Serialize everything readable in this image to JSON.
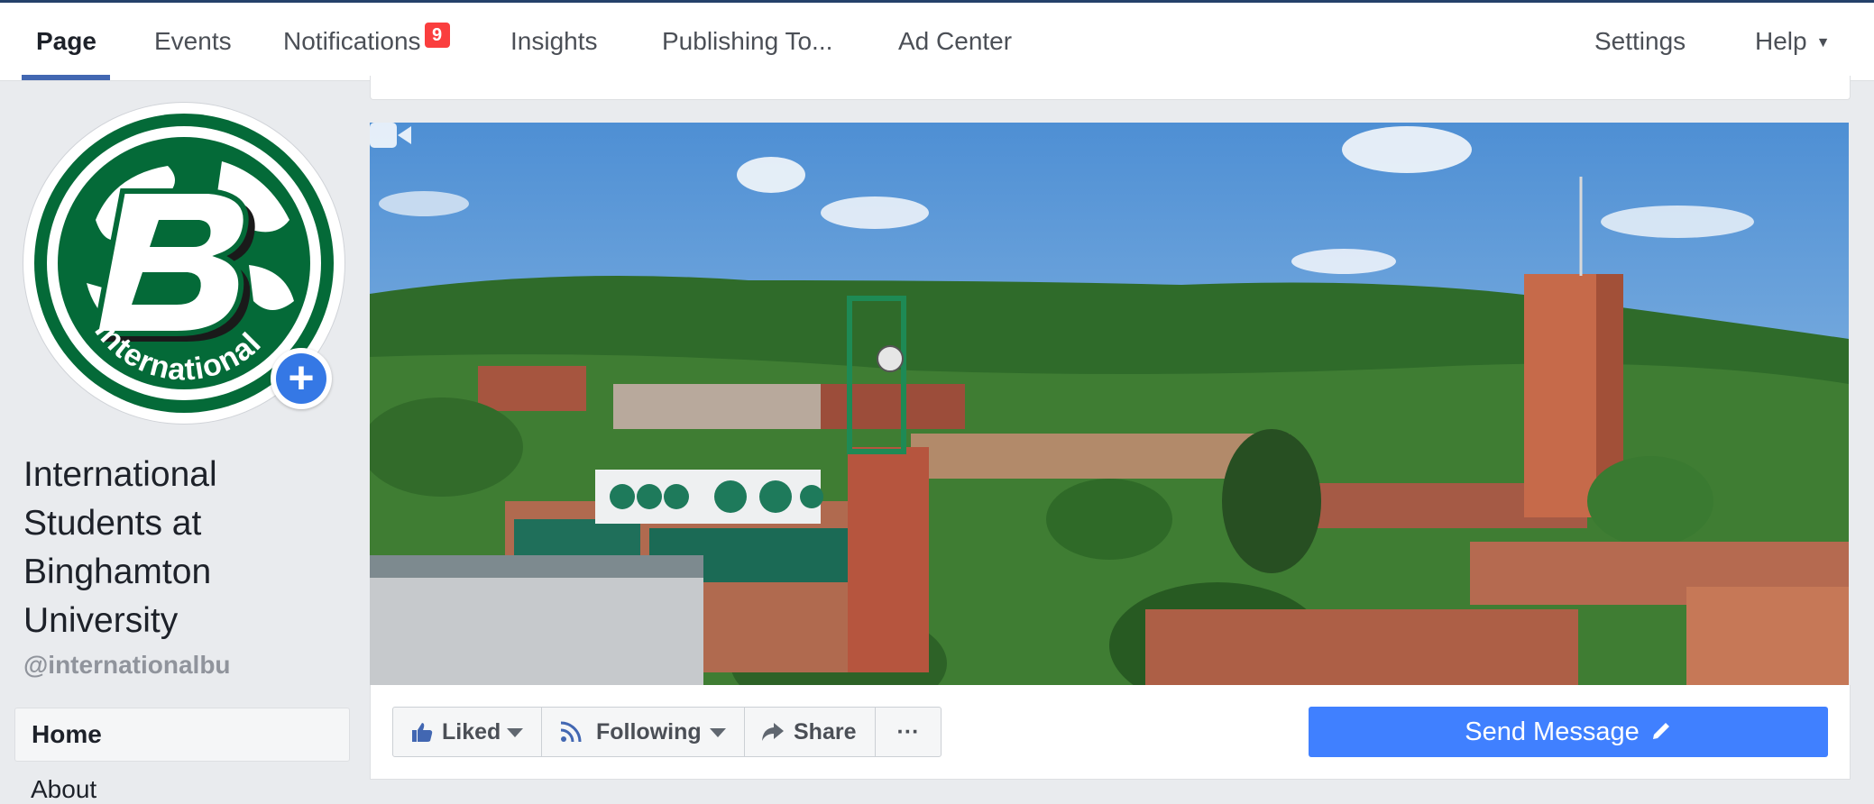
{
  "nav": {
    "items": [
      {
        "label": "Page",
        "active": true
      },
      {
        "label": "Events"
      },
      {
        "label": "Notifications",
        "badge": "9"
      },
      {
        "label": "Insights"
      },
      {
        "label": "Publishing To..."
      },
      {
        "label": "Ad Center"
      }
    ],
    "right": {
      "settings": "Settings",
      "help": "Help",
      "help_caret": "▼"
    }
  },
  "profile": {
    "logo_text": "International",
    "name": "International Students at Binghamton University",
    "name_lines": [
      "International",
      "Students at",
      "Binghamton",
      "University"
    ],
    "username": "@internationalbu"
  },
  "sidebar": {
    "items": [
      {
        "label": "Home"
      },
      {
        "label": "About"
      }
    ]
  },
  "cover": {
    "icon": "video-camera-icon"
  },
  "actions": {
    "liked": "Liked",
    "following": "Following",
    "share": "Share",
    "more": "···",
    "send_message": "Send Message"
  },
  "colors": {
    "brand_blue": "#4267b2",
    "send_button": "#4080ff",
    "badge_red": "#fa3e3e",
    "logo_green": "#046a38"
  }
}
